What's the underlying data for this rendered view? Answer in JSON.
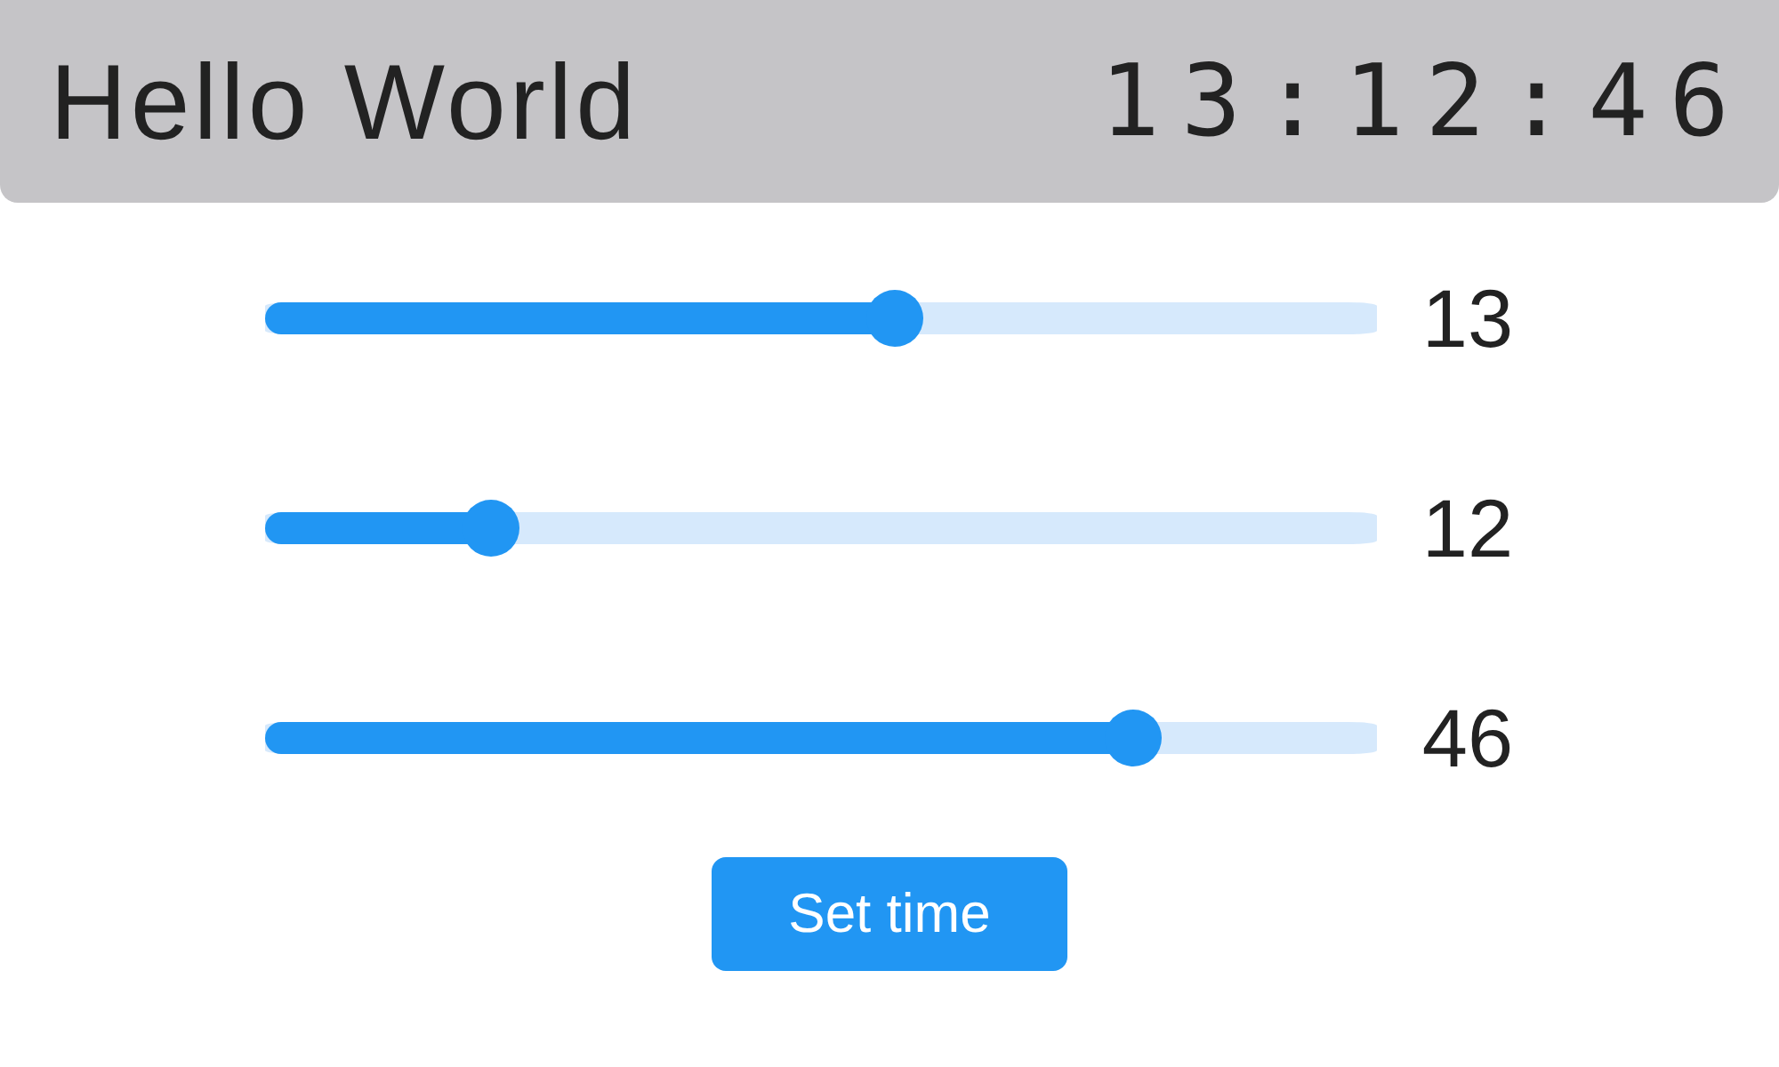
{
  "header": {
    "title": "Hello World",
    "clock": "13:12:46"
  },
  "sliders": [
    {
      "level": 0.565,
      "reading": "13"
    },
    {
      "level": 0.203,
      "reading": "12"
    },
    {
      "level": 0.78,
      "reading": "46"
    }
  ],
  "button": {
    "label": "Set time"
  }
}
